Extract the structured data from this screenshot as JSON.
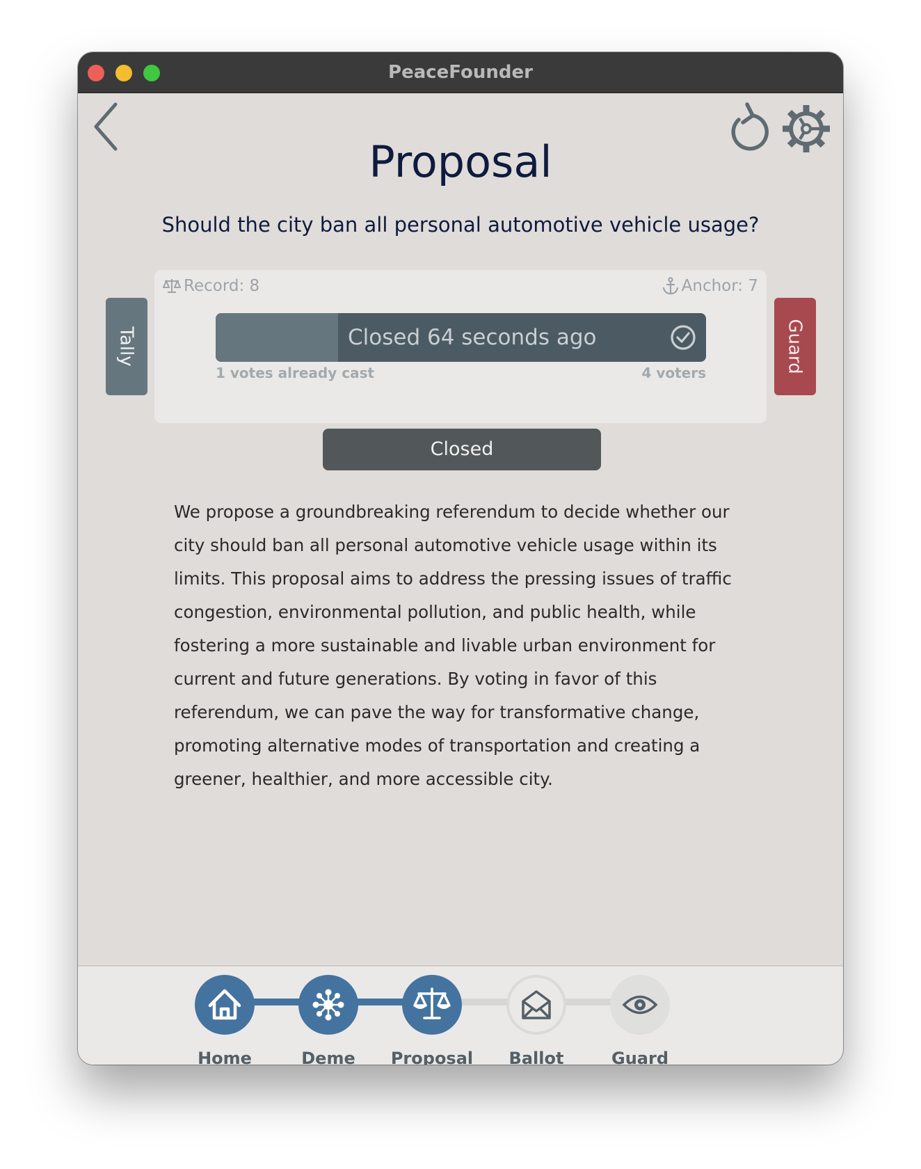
{
  "window": {
    "title": "PeaceFounder"
  },
  "header": {
    "back_icon": "chevron-left-icon",
    "refresh_icon": "refresh-icon",
    "settings_icon": "gear-icon"
  },
  "page": {
    "title": "Proposal",
    "question": "Should the city ban all personal automotive vehicle usage?"
  },
  "card": {
    "record_label": "Record: 8",
    "anchor_label": "Anchor: 7",
    "progress": {
      "status_text": "Closed 64 seconds ago",
      "fraction": 0.25
    },
    "votes_cast_text": "1 votes already cast",
    "voters_text": "4 voters"
  },
  "closed_button": {
    "label": "Closed"
  },
  "side_tabs": {
    "tally": "Tally",
    "guard": "Guard"
  },
  "description": "We propose a groundbreaking referendum to decide whether our city should ban all personal automotive vehicle usage within its limits. This proposal aims to address the pressing issues of traffic congestion, environmental pollution, and public health, while fostering a more sustainable and livable urban environment for current and future generations. By voting in favor of this referendum, we can pave the way for transformative change, promoting alternative modes of transportation and creating a greener, healthier, and more accessible city.",
  "footer": {
    "steps": [
      {
        "label": "Home",
        "icon": "home-icon",
        "state": "done"
      },
      {
        "label": "Deme",
        "icon": "network-icon",
        "state": "done"
      },
      {
        "label": "Proposal",
        "icon": "scales-icon",
        "state": "current"
      },
      {
        "label": "Ballot",
        "icon": "envelope-icon",
        "state": "pending"
      },
      {
        "label": "Guard",
        "icon": "eye-icon",
        "state": "pending"
      }
    ]
  },
  "colors": {
    "accent": "#44739f",
    "title_text": "#0e1b3e",
    "guard_tab": "#a8494f",
    "tally_tab": "#66767e",
    "progress_bar": "#4c5a63"
  }
}
